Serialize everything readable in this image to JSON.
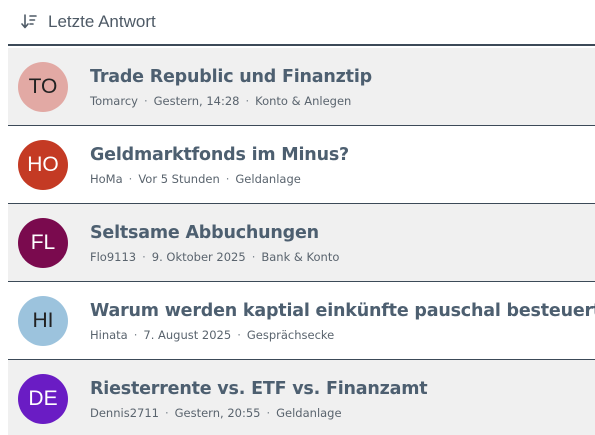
{
  "header": {
    "label": "Letzte Antwort",
    "icon": "sort-descending-icon"
  },
  "rows": [
    {
      "initials": "TO",
      "avatar_color": "#e2a9a4",
      "avatar_text_color": "#222222",
      "title": "Trade Republic und Finanztip",
      "author": "Tomarcy",
      "time": "Gestern, 14:28",
      "category": "Konto & Anlegen"
    },
    {
      "initials": "HO",
      "avatar_color": "#c43a24",
      "avatar_text_color": "#ffffff",
      "title": "Geldmarktfonds im Minus?",
      "author": "HoMa",
      "time": "Vor 5 Stunden",
      "category": "Geldanlage"
    },
    {
      "initials": "FL",
      "avatar_color": "#7a0a4e",
      "avatar_text_color": "#ffffff",
      "title": "Seltsame Abbuchungen",
      "author": "Flo9113",
      "time": "9. Oktober 2025",
      "category": "Bank & Konto"
    },
    {
      "initials": "HI",
      "avatar_color": "#9cc3dd",
      "avatar_text_color": "#222222",
      "title": "Warum werden kaptial einkünfte pauschal besteuert",
      "author": "Hinata",
      "time": "7. August 2025",
      "category": "Gesprächsecke"
    },
    {
      "initials": "DE",
      "avatar_color": "#6a1cc4",
      "avatar_text_color": "#ffffff",
      "title": "Riesterrente vs. ETF vs. Finanzamt",
      "author": "Dennis2711",
      "time": "Gestern, 20:55",
      "category": "Geldanlage"
    }
  ],
  "separator": "·"
}
